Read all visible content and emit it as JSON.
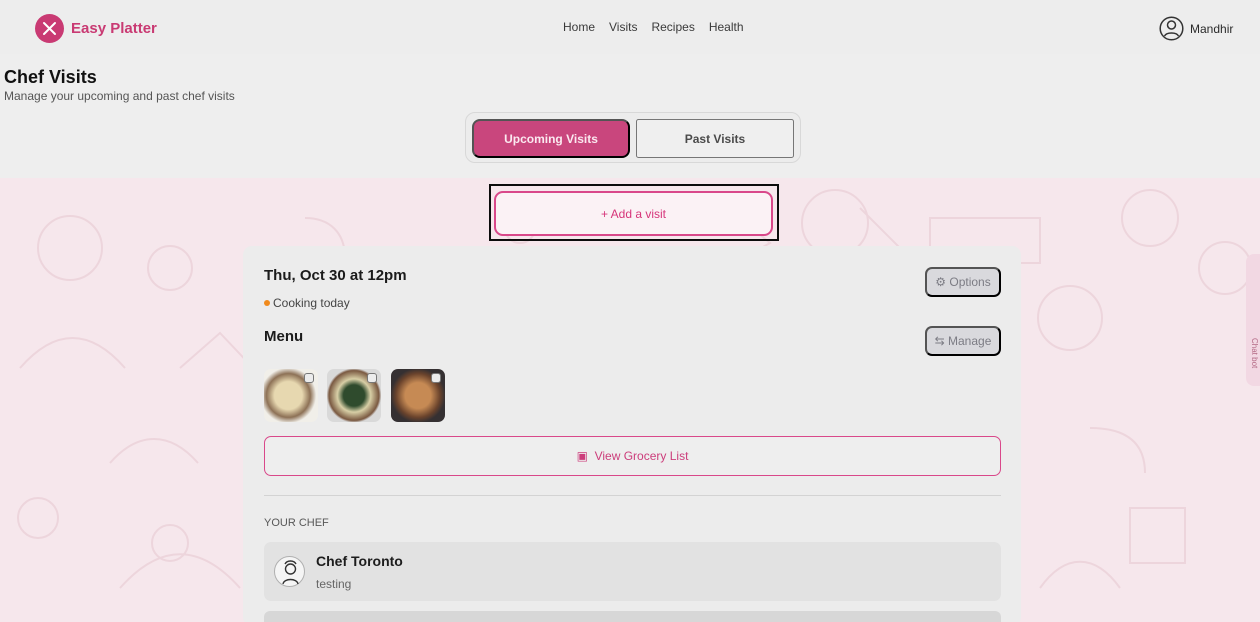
{
  "header": {
    "brand": "Easy Platter",
    "nav": [
      "Home",
      "Visits",
      "Recipes",
      "Health"
    ],
    "user_name": "Mandhir"
  },
  "page": {
    "title": "Chef Visits",
    "subtitle": "Manage your upcoming and past chef visits"
  },
  "tabs": {
    "upcoming": "Upcoming Visits",
    "past": "Past Visits"
  },
  "actions": {
    "add_visit": "+ Add a visit",
    "options": "Options",
    "manage": "Manage",
    "view_grocery_list": "View Grocery List"
  },
  "visit": {
    "date": "Thu, Oct 30 at 12pm",
    "status": "Cooking today",
    "menu_label": "Menu"
  },
  "chef": {
    "section_label": "YOUR CHEF",
    "name": "Chef Toronto",
    "description": "testing"
  },
  "side_tab": {
    "label": "Chat bot"
  },
  "colors": {
    "brand": "#c93a73",
    "accent": "#d9488a",
    "status": "#f08a1c"
  },
  "icons": {
    "logo": "utensils-icon",
    "user": "user-circle-icon",
    "options": "gear-icon",
    "manage": "sliders-icon",
    "grocery": "calendar-icon",
    "chef": "chef-avatar-icon"
  }
}
